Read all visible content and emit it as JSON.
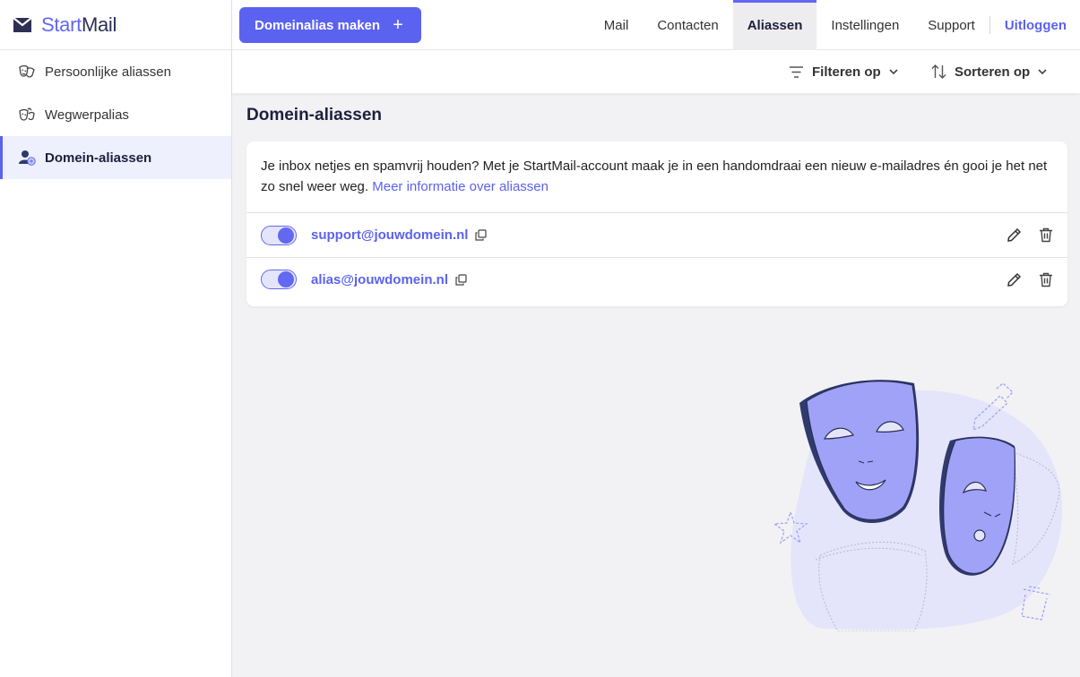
{
  "brand": {
    "part1": "Start",
    "part2": "Mail"
  },
  "sidebar": {
    "items": [
      {
        "label": "Persoonlijke aliassen",
        "icon": "masks-icon"
      },
      {
        "label": "Wegwerpalias",
        "icon": "disposable-mask-icon"
      },
      {
        "label": "Domein-aliassen",
        "icon": "domain-user-icon",
        "active": true
      }
    ]
  },
  "header": {
    "create_button": "Domeinalias maken",
    "nav": [
      "Mail",
      "Contacten",
      "Aliassen",
      "Instellingen",
      "Support"
    ],
    "active_nav": "Aliassen",
    "logout": "Uitloggen"
  },
  "toolbar": {
    "filter_label": "Filteren op",
    "sort_label": "Sorteren op"
  },
  "main": {
    "title": "Domein-aliassen",
    "intro": "Je inbox netjes en spamvrij houden? Met je StartMail-account maak je in een handomdraai een nieuw e-mailadres én gooi je het net zo snel weer weg.",
    "intro_link": "Meer informatie over aliassen",
    "aliases": [
      {
        "address": "support@jouwdomein.nl",
        "enabled": true
      },
      {
        "address": "alias@jouwdomein.nl",
        "enabled": true
      }
    ]
  },
  "colors": {
    "accent": "#5b62ef",
    "accent_light": "#e4e5fb",
    "background": "#f2f2f4",
    "illustration_blob": "#e4e5fa",
    "mask_fill": "#9fa2f7",
    "mask_dark": "#2f3a6e"
  }
}
